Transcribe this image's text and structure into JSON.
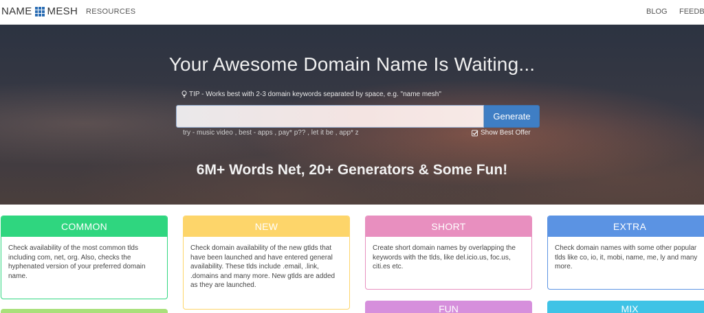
{
  "nav": {
    "logo_left": "NAME",
    "logo_right": "MESH",
    "resources": "RESOURCES",
    "blog": "BLOG",
    "feedback": "FEEDBA"
  },
  "hero": {
    "title": "Your Awesome Domain Name Is Waiting...",
    "tip": "TIP - Works best with 2-3 domain keywords separated by space, e.g. \"name mesh\"",
    "search_value": "",
    "generate_label": "Generate",
    "try_text": "try - music video , best - apps , pay* p?? , let it be , app* z",
    "best_offer_label": "Show Best Offer",
    "subtitle": "6M+ Words Net, 20+ Generators & Some Fun!"
  },
  "cards": [
    {
      "title": "COMMON",
      "color": "#2fd67f",
      "text": "Check availability of the most common tlds including com, net, org. Also, checks the hyphenated version of your preferred domain name."
    },
    {
      "title": "NEW",
      "color": "#fdd56a",
      "text": "Check domain availability of the new gtlds that have been launched and have entered general availability. These tlds include .email, .link, .domains and many more. New gtlds are added as they are launched."
    },
    {
      "title": "SHORT",
      "color": "#e88fbf",
      "text": "Create short domain names by overlapping the keywords with the tlds, like del.icio.us, foc.us, citi.es etc."
    },
    {
      "title": "EXTRA",
      "color": "#5b93e3",
      "text": "Check domain names with some other popular tlds like co, io, it, mobi, name, me, ly and many more."
    }
  ],
  "lower_cards": [
    {
      "title": "FUN",
      "color": "#d68fdc"
    },
    {
      "title": "MIX",
      "color": "#3fc3e6"
    }
  ],
  "colors": {
    "accent": "#3f7ec4",
    "lime_stub": "#a9e07a"
  }
}
